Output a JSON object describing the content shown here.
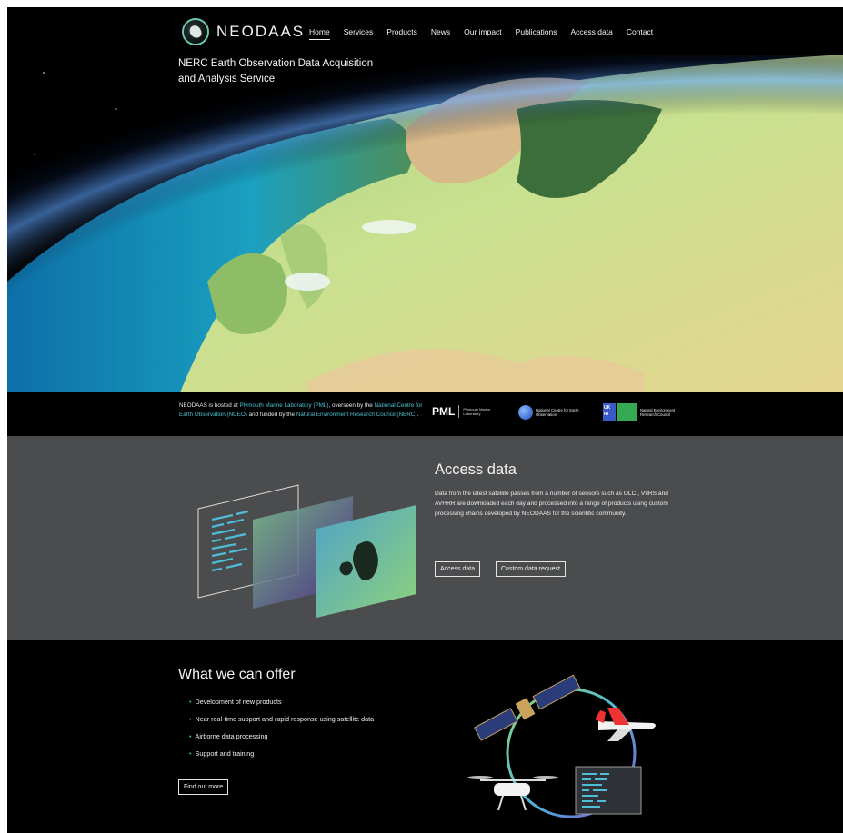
{
  "nav": {
    "logo_text": "NEODAAS",
    "items": [
      "Home",
      "Services",
      "Products",
      "News",
      "Our impact",
      "Publications",
      "Access data",
      "Contact"
    ],
    "active": "Home"
  },
  "hero": {
    "title": "NERC Earth Observation Data Acquisition and Analysis Service"
  },
  "partners": {
    "text_1": "NEODAAS is hosted at ",
    "link_pml": "Plymouth Marine Laboratory (PML)",
    "text_2": ", overseen by the ",
    "link_nceo": "National Centre for Earth Observation (NCEO)",
    "text_3": " and funded by the ",
    "link_nerc": "Natural Environment Research Council (NERC)",
    "text_4": ".",
    "pml_abbr": "PML",
    "pml_name": "Plymouth Marine Laboratory",
    "nceo_name": "National Centre for Earth Observation",
    "ukri_abbr": "UK RI",
    "nerc_name": "Natural Environment Research Council"
  },
  "access": {
    "heading": "Access data",
    "body": "Data from the latest satellite passes from a number of sensors such as OLCI, VIIRS and AVHRR are downloaded each day and processed into a range of products using custom processing chains developed by NEODAAS for the scientific community.",
    "btn_access": "Access data",
    "btn_custom": "Custom data request"
  },
  "offer": {
    "heading": "What we can offer",
    "items": [
      "Development of new products",
      "Near real-time support and rapid response using satellite data",
      "Airborne data processing",
      "Support and training"
    ],
    "btn": "Find out more"
  },
  "colors": {
    "accent": "#49b7a7",
    "link": "#4fc1d4",
    "section_grey": "#4b4c4e"
  }
}
